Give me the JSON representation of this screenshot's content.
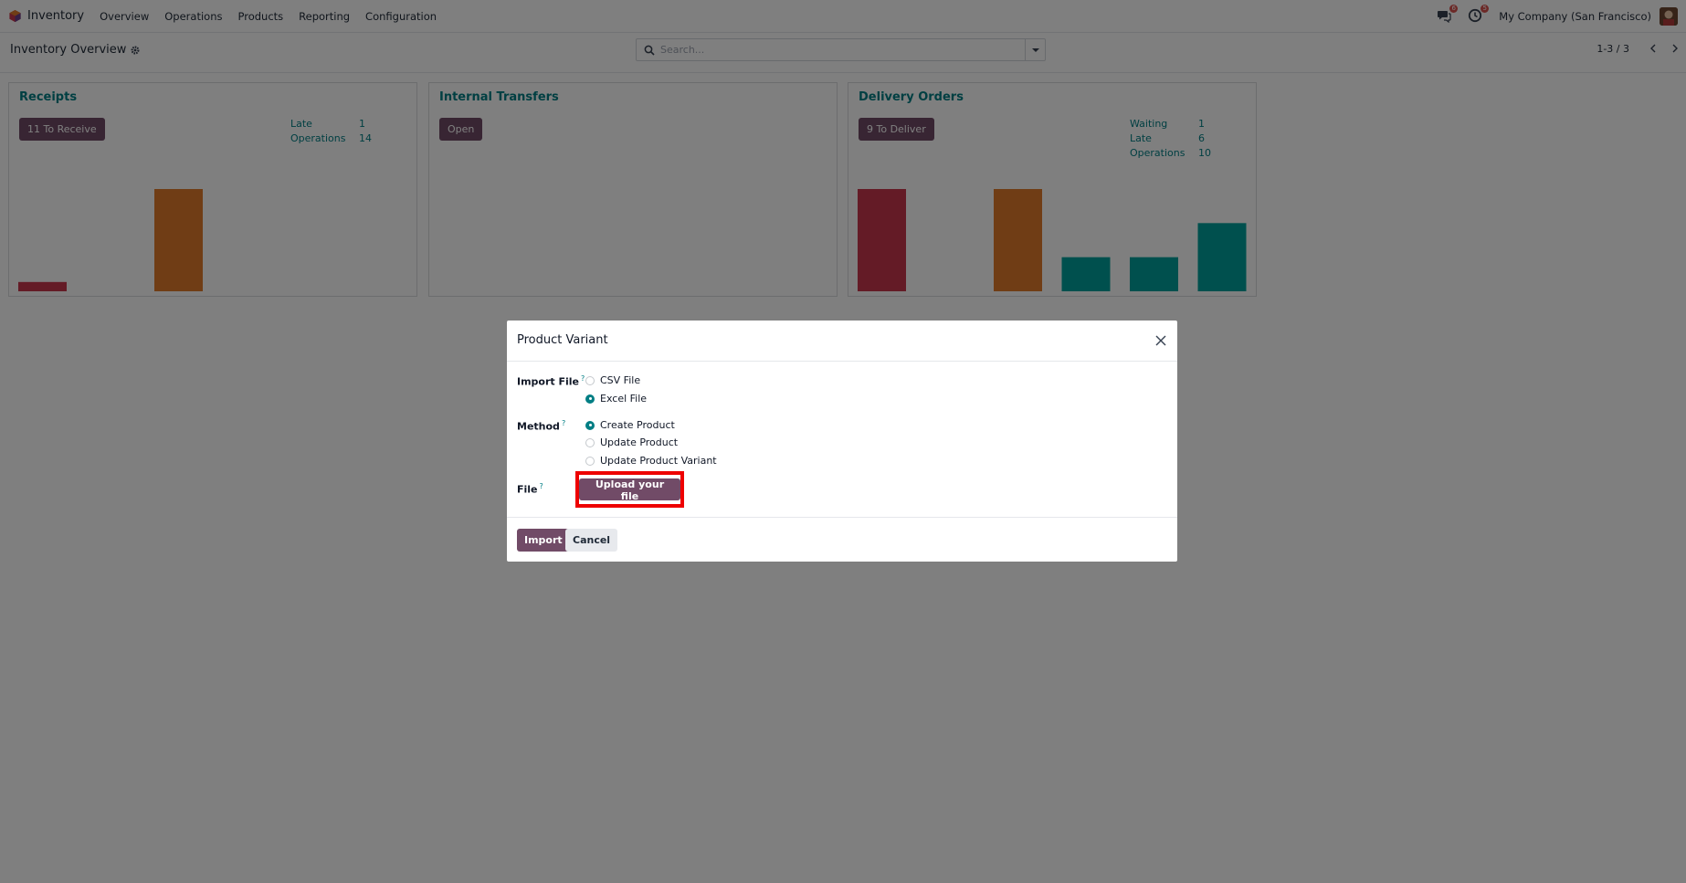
{
  "app": {
    "name": "Inventory"
  },
  "menu": [
    "Overview",
    "Operations",
    "Products",
    "Reporting",
    "Configuration"
  ],
  "navbar": {
    "messages_count": "6",
    "activities_count": "5",
    "company": "My Company (San Francisco)"
  },
  "breadcrumb": {
    "title": "Inventory Overview"
  },
  "search": {
    "placeholder": "Search..."
  },
  "pager": {
    "value": "1-3 / 3"
  },
  "cards": [
    {
      "title": "Receipts",
      "button": "11 To Receive",
      "stats": [
        {
          "label": "Late",
          "value": "1"
        },
        {
          "label": "Operations",
          "value": "14"
        }
      ],
      "bars": [
        {
          "value": 1,
          "color": "#c8374d"
        },
        {
          "value": 0,
          "color": "#e07b2a"
        },
        {
          "value": 11,
          "color": "#e07b2a"
        },
        {
          "value": 0,
          "color": "#00a09d"
        },
        {
          "value": 0,
          "color": "#00a09d"
        },
        {
          "value": 0,
          "color": "#00a09d"
        }
      ],
      "bar_max": 11
    },
    {
      "title": "Internal Transfers",
      "button": "Open",
      "stats": [],
      "bars": [],
      "bar_max": 1
    },
    {
      "title": "Delivery Orders",
      "button": "9 To Deliver",
      "stats": [
        {
          "label": "Waiting",
          "value": "1"
        },
        {
          "label": "Late",
          "value": "6"
        },
        {
          "label": "Operations",
          "value": "10"
        }
      ],
      "bars": [
        {
          "value": 3,
          "color": "#c8374d"
        },
        {
          "value": 0,
          "color": "#e07b2a"
        },
        {
          "value": 3,
          "color": "#e07b2a"
        },
        {
          "value": 1,
          "color": "#00a09d"
        },
        {
          "value": 1,
          "color": "#00a09d"
        },
        {
          "value": 2,
          "color": "#00a09d"
        }
      ],
      "bar_max": 3
    }
  ],
  "modal": {
    "title": "Product Variant",
    "import_file_label": "Import File",
    "import_options": [
      {
        "label": "CSV File",
        "checked": false
      },
      {
        "label": "Excel File",
        "checked": true
      }
    ],
    "method_label": "Method",
    "method_options": [
      {
        "label": "Create Product",
        "checked": true
      },
      {
        "label": "Update Product",
        "checked": false
      },
      {
        "label": "Update Product Variant",
        "checked": false
      }
    ],
    "file_label": "File",
    "upload_label": "Upload your file",
    "import_label": "Import",
    "cancel_label": "Cancel",
    "help_marker": "?"
  },
  "colors": {
    "brand": "#714b67",
    "accent": "#017e84",
    "highlight": "#ee0000"
  }
}
